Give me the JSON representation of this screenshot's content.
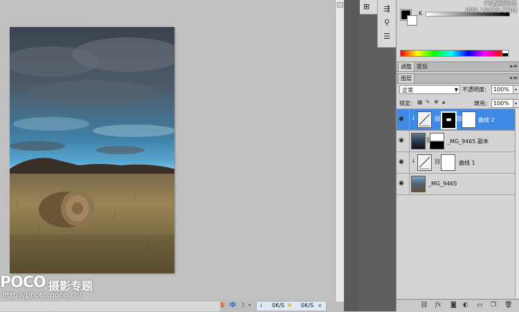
{
  "watermark": {
    "line1": "PS教程论坛",
    "line2": "BBS.16XX8.COM"
  },
  "logo": {
    "brand": "POCO",
    "subtitle": "摄影专题",
    "url": "http://photo.poco.co/"
  },
  "color_panel": {
    "k_label": "K"
  },
  "tabs_top": [
    {
      "label": "调整",
      "active": true
    },
    {
      "label": "蒙版",
      "active": false
    }
  ],
  "tabs_layers": [
    {
      "label": "图层",
      "active": true
    }
  ],
  "layers_panel": {
    "blend_mode": "正常",
    "opacity_label": "不透明度:",
    "opacity_value": "100%",
    "lock_label": "锁定:",
    "fill_label": "填充:",
    "fill_value": "100%"
  },
  "layers": [
    {
      "name": "曲线 2",
      "type": "curves",
      "clipped": true,
      "selected": true
    },
    {
      "name": "_MG_9465 副本",
      "type": "image-mask",
      "clipped": false,
      "selected": false
    },
    {
      "name": "曲线 1",
      "type": "curves",
      "clipped": true,
      "selected": false
    },
    {
      "name": "_MG_9465",
      "type": "image",
      "clipped": false,
      "selected": false
    }
  ],
  "taskbar": {
    "down_speed": "0K/S",
    "up_speed": "0K/S",
    "ime_label": "中"
  },
  "colors": {
    "selected_layer": "#3f8ae5",
    "panel_bg": "#d4d4d4",
    "canvas_bg": "#c0c0c0"
  }
}
